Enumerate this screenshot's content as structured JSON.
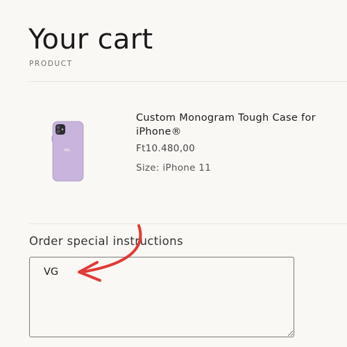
{
  "page": {
    "title": "Your cart"
  },
  "table": {
    "product_header": "PRODUCT"
  },
  "cart_items": [
    {
      "title": "Custom Monogram Tough Case for iPhone®",
      "price": "Ft10.480,00",
      "variant": "Size: iPhone 11",
      "image_color": "#c8b4dc"
    }
  ],
  "instructions": {
    "label": "Order special instructions",
    "value": "VG"
  },
  "colors": {
    "background": "#faf8f5",
    "annotation_arrow": "#e23a36",
    "phone_case": "#c8b4dc"
  }
}
